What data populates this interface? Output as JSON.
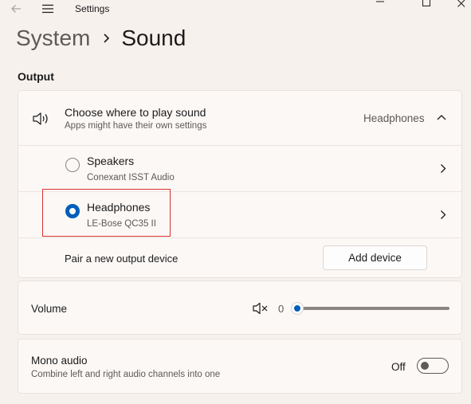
{
  "window": {
    "title": "Settings"
  },
  "breadcrumb": {
    "parent": "System",
    "current": "Sound"
  },
  "output": {
    "section_label": "Output",
    "choose": {
      "title": "Choose where to play sound",
      "subtitle": "Apps might have their own settings",
      "selected_value": "Headphones"
    },
    "devices": [
      {
        "name": "Speakers",
        "detail": "Conexant ISST Audio",
        "selected": false
      },
      {
        "name": "Headphones",
        "detail": "LE-Bose QC35 II",
        "selected": true
      }
    ],
    "pair": {
      "label": "Pair a new output device",
      "button": "Add device"
    }
  },
  "volume": {
    "label": "Volume",
    "value_text": "0",
    "level": 0
  },
  "mono_audio": {
    "title": "Mono audio",
    "subtitle": "Combine left and right audio channels into one",
    "state_text": "Off",
    "enabled": false
  },
  "colors": {
    "accent": "#005fb8",
    "highlight_box": "#d9312f",
    "background": "#f7f1ee"
  },
  "icons": {
    "back": "back-arrow-icon",
    "menu": "hamburger-menu-icon",
    "speaker": "speaker-icon",
    "mute": "speaker-muted-icon",
    "chevron": "chevron-right-icon",
    "collapse": "chevron-up-icon"
  }
}
